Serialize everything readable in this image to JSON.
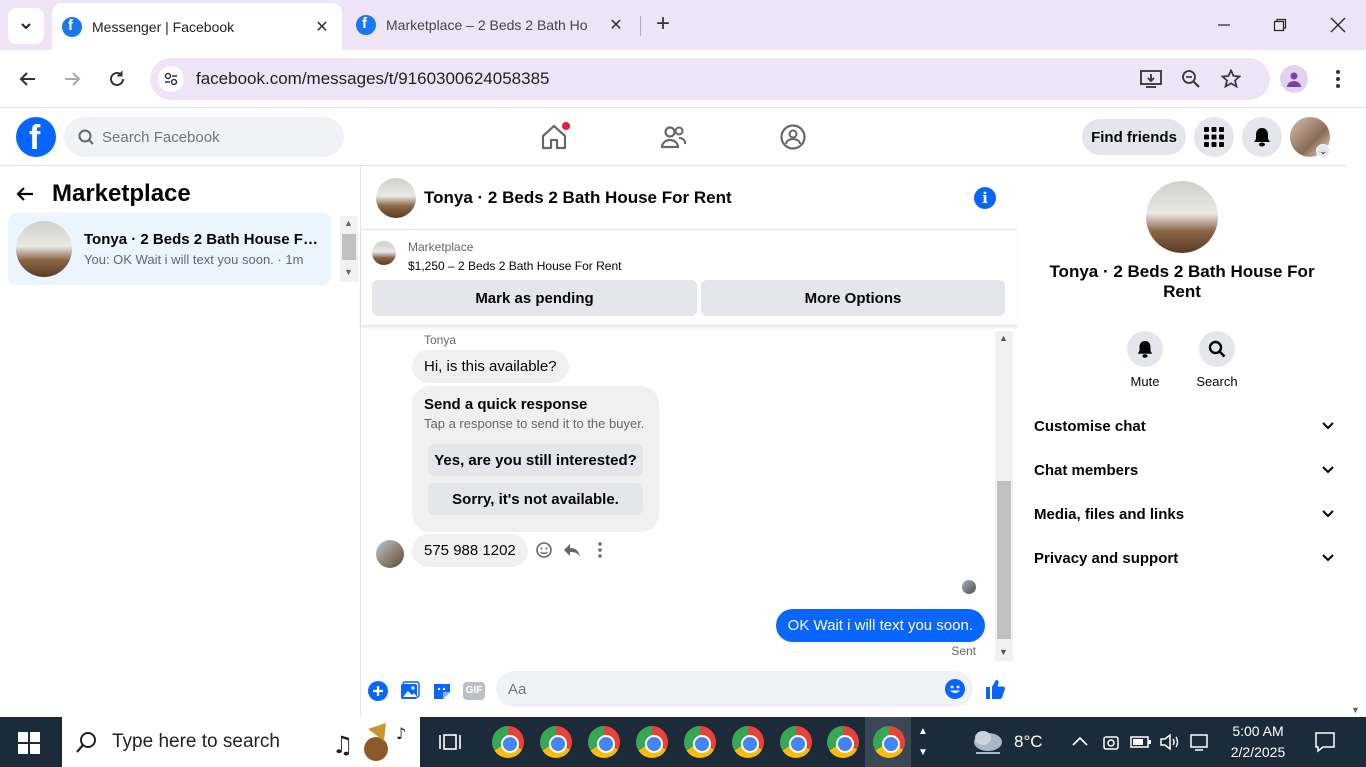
{
  "browser": {
    "tabs": [
      {
        "title": "Messenger | Facebook",
        "active": true
      },
      {
        "title": "Marketplace – 2 Beds 2 Bath Ho",
        "active": false
      }
    ],
    "url": "facebook.com/messages/t/9160300624058385"
  },
  "facebook": {
    "search_placeholder": "Search Facebook",
    "find_friends": "Find friends"
  },
  "left_panel": {
    "title": "Marketplace",
    "conversation": {
      "name": "Tonya · 2 Beds 2 Bath House Fo...",
      "last_message": "You: OK Wait i will text you soon. · 1m"
    }
  },
  "chat": {
    "title": "Tonya · 2 Beds 2 Bath House For Rent",
    "listing": {
      "label": "Marketplace",
      "price_title": "$1,250 – 2 Beds 2 Bath House For Rent",
      "mark_pending": "Mark as pending",
      "more_options": "More Options"
    },
    "sender_name": "Tonya",
    "message_1": "Hi, is this available?",
    "quick_response": {
      "title": "Send a quick response",
      "subtitle": "Tap a response to send it to the buyer.",
      "option_1": "Yes, are you still interested?",
      "option_2": "Sorry, it's not available."
    },
    "message_2": "575 988 1202",
    "my_message": "OK Wait i will text you soon.",
    "status": "Sent",
    "composer_placeholder": "Aa",
    "gif_label": "GIF"
  },
  "right_panel": {
    "name": "Tonya · 2 Beds 2 Bath House For Rent",
    "mute": "Mute",
    "search": "Search",
    "sections": [
      "Customise chat",
      "Chat members",
      "Media, files and links",
      "Privacy and support"
    ]
  },
  "taskbar": {
    "search_placeholder": "Type here to search",
    "temperature": "8°C",
    "time": "5:00 AM",
    "date": "2/2/2025"
  },
  "colors": {
    "messenger_blue": "#0866ff",
    "tabstrip": "#efe4f7",
    "taskbar": "#1c2b3a"
  }
}
